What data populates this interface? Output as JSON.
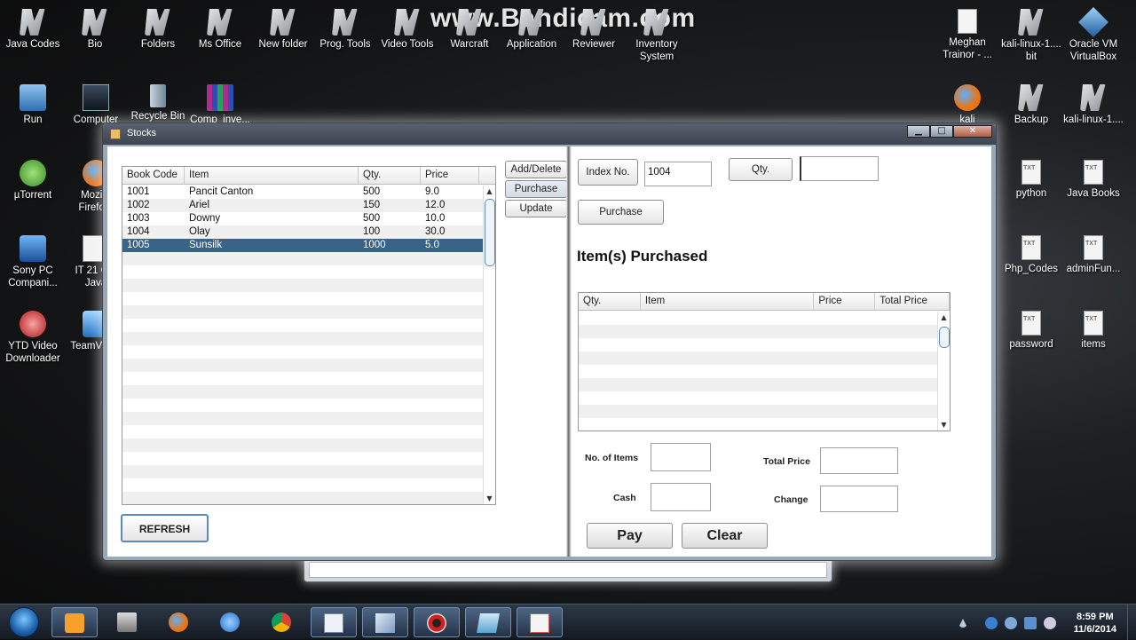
{
  "watermark": "www.Bandicam.com",
  "desktop": {
    "row1": [
      "Java Codes",
      "Bio",
      "Folders",
      "Ms Office",
      "New folder",
      "Prog. Tools",
      "Video Tools",
      "Warcraft",
      "Application",
      "Reviewer",
      "Inventory System"
    ],
    "left_col": [
      "Run",
      "µTorrent",
      "Sony PC Compani...",
      "YTD Video Downloader"
    ],
    "second_col": [
      "Computer",
      "Mozi... Firefo...",
      "IT 21 C... Java",
      "TeamVi... 9"
    ],
    "row2_extra": [
      "Recycle Bin",
      "Comp_inve..."
    ],
    "right": {
      "meghan": "Meghan Trainor - ...",
      "kali_bit": "kali-linux-1.... bit",
      "oracle": "Oracle VM VirtualBox",
      "kali": "kali",
      "backup": "Backup",
      "kali2": "kali-linux-1....",
      "python": "python",
      "java_books": "Java Books",
      "php": "Php_Codes",
      "adminfun": "adminFun...",
      "password": "password",
      "items": "items"
    }
  },
  "window": {
    "title": "Stocks",
    "controls": {
      "minimize": "▁",
      "maximize": "□",
      "close": "✕"
    }
  },
  "stock_table": {
    "columns": [
      "Book Code",
      "Item",
      "Qty.",
      "Price"
    ],
    "rows": [
      [
        "1001",
        "Pancit Canton",
        "500",
        "9.0"
      ],
      [
        "1002",
        "Ariel",
        "150",
        "12.0"
      ],
      [
        "1003",
        "Downy",
        "500",
        "10.0"
      ],
      [
        "1004",
        "Olay",
        "100",
        "30.0"
      ],
      [
        "1005",
        "Sunsilk",
        "1000",
        "5.0"
      ]
    ],
    "selected_row": 4
  },
  "refresh_label": "REFRESH",
  "tabs": [
    "Add/Delete",
    "Purchase",
    "Update"
  ],
  "purchase": {
    "index_label": "Index No.",
    "index_value": "1004",
    "qty_label": "Qty.",
    "qty_value": "",
    "purchase_button": "Purchase",
    "heading": "Item(s) Purchased",
    "table_columns": [
      "Qty.",
      "Item",
      "Price",
      "Total Price"
    ],
    "no_items_label": "No. of Items",
    "cash_label": "Cash",
    "total_price_label": "Total Price",
    "change_label": "Change",
    "pay_button": "Pay",
    "clear_button": "Clear"
  },
  "taskbar": {
    "time": "8:59 PM",
    "date": "11/6/2014"
  }
}
